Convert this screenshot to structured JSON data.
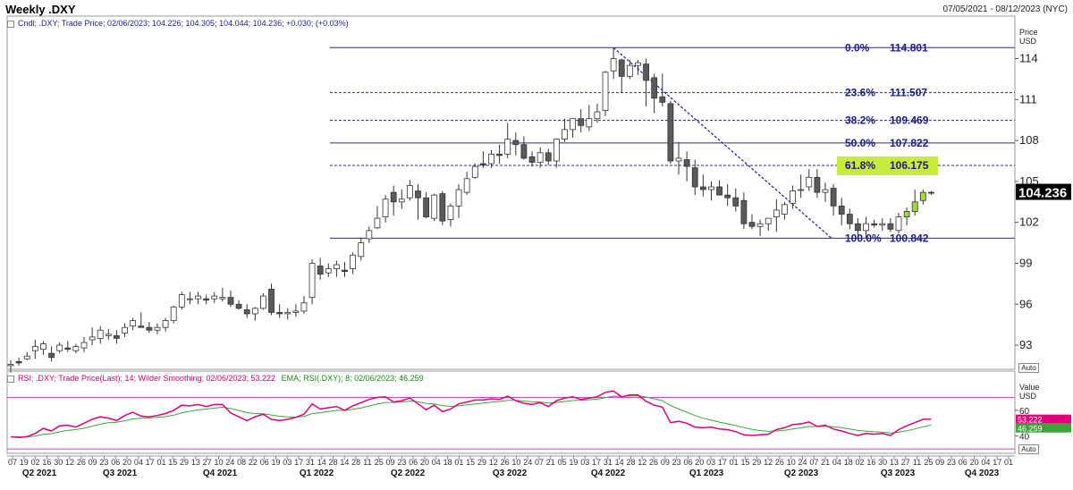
{
  "header": {
    "title": "Weekly .DXY",
    "date_range": "07/05/2021 - 08/12/2023 (NYC)",
    "info_line": "Cndl; .DXY; Trade Price; 02/06/2023; 104.226; 104.305; 104.044; 104.236; +0.030; (+0.03%)"
  },
  "price_axis": {
    "label_line1": "Price",
    "label_line2": "USD",
    "ticks": [
      93,
      96,
      99,
      102,
      105,
      108,
      111,
      114
    ],
    "tick_labels": [
      "93",
      "96",
      "99",
      "102",
      "105",
      "108",
      "111",
      "114"
    ],
    "ylim": [
      91.3,
      116.0
    ],
    "last_price": "104.236",
    "auto": "Auto"
  },
  "fibonacci": [
    {
      "pct": "0.0%",
      "value": "114.801",
      "level": 114.801,
      "style": "solid"
    },
    {
      "pct": "23.6%",
      "value": "111.507",
      "level": 111.507,
      "style": "dashed"
    },
    {
      "pct": "38.2%",
      "value": "109.469",
      "level": 109.469,
      "style": "dashed"
    },
    {
      "pct": "50.0%",
      "value": "107.822",
      "level": 107.822,
      "style": "solid"
    },
    {
      "pct": "61.8%",
      "value": "106.175",
      "level": 106.175,
      "style": "dashed",
      "highlight": "#c7ec3c"
    },
    {
      "pct": "100.0%",
      "value": "100.842",
      "level": 100.842,
      "style": "solid"
    }
  ],
  "rsi_panel": {
    "rsi_label": "RSI; .DXY; Trade Price(Last); 14; Wilder Smoothing; 02/06/2023; 53.222",
    "ema_label": "EMA; RSI(.DXY); 8; 02/06/2023; 46.259",
    "label_line1": "Value",
    "label_line2": "USD",
    "ticks": [
      40,
      60
    ],
    "tick_labels": [
      "40",
      "60"
    ],
    "ylim": [
      28,
      78
    ],
    "upper_level": 70,
    "lower_level": 30,
    "rsi_last": "53.222",
    "ema_last": "46.259",
    "rsi_color": "#e0007a",
    "ema_color": "#3aa63a",
    "auto": "Auto"
  },
  "x_axis": {
    "day_ticks": [
      "07",
      "19",
      "02",
      "16",
      "30",
      "12",
      "26",
      "09",
      "23",
      "06",
      "20",
      "04",
      "17",
      "01",
      "15",
      "29",
      "13",
      "27",
      "10",
      "24",
      "08",
      "22",
      "06",
      "19",
      "03",
      "17",
      "31",
      "14",
      "28",
      "14",
      "28",
      "11",
      "25",
      "09",
      "23",
      "06",
      "20",
      "04",
      "18",
      "01",
      "15",
      "29",
      "12",
      "26",
      "10",
      "24",
      "07",
      "21",
      "05",
      "19",
      "03",
      "17",
      "31",
      "14",
      "28",
      "12",
      "26",
      "09",
      "23",
      "06",
      "20",
      "03",
      "17",
      "01",
      "15",
      "29",
      "12",
      "26",
      "10",
      "24",
      "07",
      "21",
      "04",
      "18",
      "02",
      "16",
      "30",
      "13",
      "27",
      "11",
      "25",
      "09",
      "23",
      "06",
      "20",
      "04",
      "17",
      "01"
    ],
    "quarters": [
      "Q2 2021",
      "Q3 2021",
      "Q4 2021",
      "Q1 2022",
      "Q2 2022",
      "Q3 2022",
      "Q4 2022",
      "Q1 2023",
      "Q2 2023",
      "Q3 2023",
      "Q4 2023"
    ]
  },
  "chart_data": {
    "type": "candlestick",
    "title": "Weekly .DXY",
    "ylabel": "Price USD",
    "ylim": [
      91.3,
      116.0
    ],
    "interval": "weekly",
    "ohlc": [
      [
        91.5,
        91.9,
        91.0,
        91.6
      ],
      [
        91.8,
        92.1,
        91.5,
        91.7
      ],
      [
        92.0,
        92.5,
        91.9,
        92.2
      ],
      [
        92.6,
        93.4,
        92.0,
        92.9
      ],
      [
        92.7,
        93.3,
        92.3,
        93.1
      ],
      [
        92.4,
        92.9,
        91.8,
        92.1
      ],
      [
        92.6,
        93.2,
        92.4,
        93.0
      ],
      [
        92.8,
        93.3,
        92.5,
        92.7
      ],
      [
        92.6,
        93.1,
        92.4,
        92.9
      ],
      [
        92.8,
        93.6,
        92.5,
        93.2
      ],
      [
        93.4,
        94.3,
        93.0,
        93.6
      ],
      [
        93.5,
        94.4,
        93.1,
        94.1
      ],
      [
        93.7,
        94.2,
        93.4,
        93.8
      ],
      [
        93.7,
        94.1,
        93.1,
        93.5
      ],
      [
        93.9,
        94.6,
        93.6,
        94.3
      ],
      [
        94.4,
        95.0,
        94.1,
        94.8
      ],
      [
        94.4,
        95.4,
        94.3,
        94.3
      ],
      [
        94.3,
        94.7,
        93.9,
        94.1
      ],
      [
        94.1,
        94.6,
        93.8,
        94.3
      ],
      [
        94.3,
        95.0,
        94.0,
        94.8
      ],
      [
        94.8,
        95.9,
        94.6,
        95.8
      ],
      [
        95.8,
        96.9,
        95.6,
        96.7
      ],
      [
        96.4,
        96.9,
        96.0,
        96.4
      ],
      [
        96.4,
        96.9,
        96.0,
        96.6
      ],
      [
        96.4,
        96.7,
        96.0,
        96.3
      ],
      [
        96.4,
        96.9,
        96.1,
        96.6
      ],
      [
        96.4,
        97.2,
        96.2,
        96.5
      ],
      [
        96.5,
        97.0,
        95.8,
        96.0
      ],
      [
        96.0,
        96.3,
        95.6,
        95.7
      ],
      [
        95.6,
        96.0,
        95.0,
        95.3
      ],
      [
        95.3,
        95.8,
        94.8,
        95.7
      ],
      [
        95.7,
        96.8,
        95.6,
        96.6
      ],
      [
        97.1,
        97.5,
        95.2,
        95.4
      ],
      [
        95.4,
        96.0,
        95.0,
        95.3
      ],
      [
        95.3,
        95.7,
        94.9,
        95.4
      ],
      [
        95.4,
        96.0,
        95.1,
        95.5
      ],
      [
        95.5,
        96.6,
        95.3,
        96.1
      ],
      [
        96.5,
        99.3,
        96.0,
        99.0
      ],
      [
        98.8,
        99.4,
        97.8,
        98.2
      ],
      [
        98.3,
        99.0,
        98.0,
        98.6
      ],
      [
        98.6,
        99.2,
        98.0,
        98.9
      ],
      [
        98.5,
        99.1,
        98.0,
        98.4
      ],
      [
        98.6,
        99.8,
        98.2,
        99.6
      ],
      [
        99.5,
        100.9,
        99.2,
        100.5
      ],
      [
        100.8,
        101.7,
        100.5,
        101.4
      ],
      [
        101.6,
        103.2,
        101.5,
        102.3
      ],
      [
        102.4,
        104.0,
        102.0,
        103.7
      ],
      [
        104.2,
        104.7,
        102.5,
        103.5
      ],
      [
        103.5,
        104.4,
        103.0,
        103.7
      ],
      [
        103.8,
        105.1,
        103.6,
        104.7
      ],
      [
        104.3,
        104.8,
        102.2,
        103.8
      ],
      [
        103.8,
        104.2,
        102.3,
        102.4
      ],
      [
        102.3,
        104.1,
        102.1,
        104.0
      ],
      [
        104.1,
        104.3,
        101.8,
        102.1
      ],
      [
        102.2,
        103.4,
        101.7,
        103.2
      ],
      [
        103.2,
        104.8,
        102.3,
        104.4
      ],
      [
        104.2,
        105.7,
        104.0,
        105.2
      ],
      [
        105.3,
        106.3,
        105.2,
        106.1
      ],
      [
        106.3,
        107.2,
        106.0,
        106.2
      ],
      [
        106.3,
        107.3,
        106.0,
        107.0
      ],
      [
        107.0,
        107.7,
        106.3,
        106.9
      ],
      [
        107.0,
        109.3,
        106.7,
        108.1
      ],
      [
        108.0,
        108.6,
        106.9,
        107.7
      ],
      [
        107.7,
        108.3,
        106.6,
        106.7
      ],
      [
        106.8,
        107.2,
        106.1,
        106.4
      ],
      [
        106.4,
        107.5,
        106.0,
        107.1
      ],
      [
        107.1,
        107.4,
        106.2,
        106.5
      ],
      [
        106.5,
        108.0,
        106.0,
        108.1
      ],
      [
        108.1,
        109.6,
        107.9,
        108.8
      ],
      [
        108.8,
        109.5,
        108.2,
        109.6
      ],
      [
        109.6,
        110.3,
        108.6,
        109.1
      ],
      [
        109.0,
        110.6,
        108.7,
        109.6
      ],
      [
        109.6,
        110.7,
        109.3,
        110.1
      ],
      [
        110.2,
        113.1,
        109.8,
        113.0
      ],
      [
        113.1,
        114.8,
        112.5,
        114.0
      ],
      [
        113.9,
        114.0,
        111.5,
        112.7
      ],
      [
        112.7,
        113.9,
        112.5,
        113.5
      ],
      [
        113.5,
        113.9,
        112.8,
        113.7
      ],
      [
        113.6,
        114.0,
        110.5,
        112.4
      ],
      [
        112.6,
        112.9,
        110.0,
        111.1
      ],
      [
        111.2,
        112.9,
        110.5,
        110.8
      ],
      [
        110.7,
        110.9,
        106.3,
        106.5
      ],
      [
        106.5,
        107.9,
        105.5,
        106.7
      ],
      [
        106.6,
        107.2,
        105.0,
        106.1
      ],
      [
        106.0,
        106.6,
        104.0,
        104.6
      ],
      [
        104.6,
        105.5,
        103.9,
        104.4
      ],
      [
        104.4,
        105.0,
        103.6,
        104.6
      ],
      [
        104.6,
        105.1,
        104.0,
        104.0
      ],
      [
        104.0,
        104.8,
        103.2,
        103.8
      ],
      [
        103.8,
        104.5,
        102.8,
        103.2
      ],
      [
        103.6,
        104.2,
        101.5,
        101.9
      ],
      [
        102.0,
        102.6,
        101.5,
        101.7
      ],
      [
        101.7,
        102.2,
        101.0,
        101.9
      ],
      [
        101.9,
        102.3,
        101.4,
        102.3
      ],
      [
        102.4,
        103.7,
        101.3,
        102.9
      ],
      [
        102.6,
        103.5,
        102.2,
        103.3
      ],
      [
        103.4,
        104.7,
        103.0,
        104.3
      ],
      [
        104.4,
        105.5,
        103.8,
        104.4
      ],
      [
        104.6,
        105.9,
        104.3,
        105.3
      ],
      [
        105.3,
        105.9,
        103.8,
        104.2
      ],
      [
        104.2,
        104.9,
        103.5,
        104.4
      ],
      [
        104.5,
        104.8,
        102.5,
        103.2
      ],
      [
        103.2,
        103.8,
        101.8,
        102.6
      ],
      [
        102.6,
        103.0,
        101.5,
        101.9
      ],
      [
        101.9,
        102.3,
        101.0,
        101.4
      ],
      [
        101.4,
        102.4,
        100.8,
        101.9
      ],
      [
        101.9,
        102.2,
        101.6,
        101.8
      ],
      [
        101.8,
        102.3,
        101.4,
        101.9
      ],
      [
        101.9,
        102.3,
        101.3,
        101.5
      ],
      [
        101.4,
        102.7,
        101.2,
        102.4
      ],
      [
        102.4,
        103.1,
        101.8,
        102.8
      ],
      [
        102.8,
        104.4,
        102.5,
        103.5
      ],
      [
        103.6,
        104.4,
        103.3,
        104.2
      ],
      [
        104.2,
        104.3,
        104.0,
        104.2
      ]
    ],
    "rsi": [
      39.5,
      39.0,
      39.5,
      42.0,
      46.0,
      44.0,
      48.0,
      48.5,
      47.0,
      50.0,
      53.0,
      55.0,
      54.0,
      52.0,
      56.0,
      58.5,
      55.5,
      55.0,
      56.0,
      57.5,
      60.0,
      64.0,
      63.5,
      64.5,
      63.0,
      64.5,
      64.5,
      58.0,
      55.0,
      52.0,
      55.0,
      57.0,
      53.0,
      52.0,
      53.0,
      54.5,
      57.0,
      65.0,
      61.0,
      62.0,
      63.0,
      60.0,
      63.5,
      66.0,
      68.5,
      70.0,
      70.5,
      66.5,
      67.5,
      69.5,
      65.0,
      60.5,
      64.0,
      59.0,
      61.0,
      65.0,
      66.5,
      68.0,
      68.0,
      69.0,
      68.5,
      71.0,
      67.5,
      65.5,
      64.5,
      66.0,
      63.0,
      67.5,
      69.5,
      70.5,
      68.5,
      69.5,
      70.5,
      74.0,
      75.0,
      70.5,
      72.0,
      72.0,
      67.0,
      64.0,
      62.5,
      50.5,
      51.5,
      50.0,
      47.0,
      46.5,
      47.0,
      45.5,
      45.0,
      43.5,
      41.0,
      40.5,
      41.0,
      41.5,
      45.0,
      46.5,
      49.0,
      49.5,
      51.0,
      47.5,
      48.5,
      45.5,
      44.0,
      42.0,
      40.5,
      42.0,
      41.5,
      42.0,
      40.5,
      45.0,
      48.0,
      50.5,
      53.0,
      53.2
    ]
  }
}
